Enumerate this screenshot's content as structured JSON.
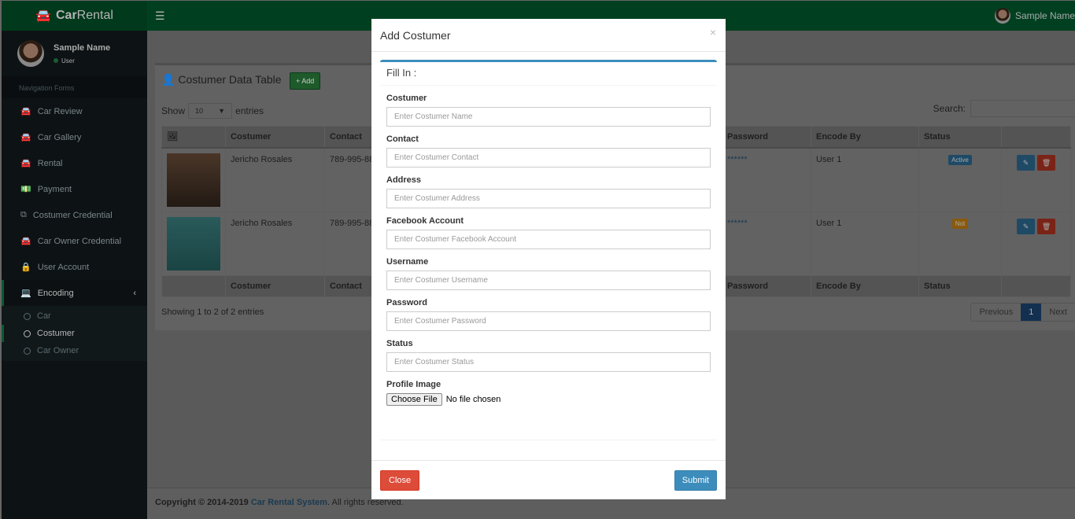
{
  "header": {
    "logo_bold": "Car",
    "logo_rest": "Rental",
    "user_name": "Sample Name"
  },
  "sidebar": {
    "user_name": "Sample Name",
    "user_status": "User",
    "nav_header": "Navigation Forms",
    "items": [
      {
        "label": "Car Review",
        "icon": "car-icon"
      },
      {
        "label": "Car Gallery",
        "icon": "car-icon"
      },
      {
        "label": "Rental",
        "icon": "car-icon"
      },
      {
        "label": "Payment",
        "icon": "money-icon"
      },
      {
        "label": "Costumer Credential",
        "icon": "copy-icon"
      },
      {
        "label": "Car Owner Credential",
        "icon": "car-icon"
      },
      {
        "label": "User Account",
        "icon": "lock-icon"
      }
    ],
    "encoding": {
      "label": "Encoding",
      "sub": [
        "Car",
        "Costumer",
        "Car Owner"
      ]
    }
  },
  "box": {
    "title": "Costumer Data Table",
    "add_label": "Add",
    "show_label": "Show",
    "entries_label": "entries",
    "show_value": "10",
    "search_label": "Search:",
    "columns": [
      "Costumer",
      "Contact",
      "Password",
      "Encode By",
      "Status"
    ],
    "rows": [
      {
        "costumer": "Jericho Rosales",
        "contact": "789-995-88",
        "password": "******",
        "encode_by": "User 1",
        "status": "Active",
        "status_color": "#3c8dbc"
      },
      {
        "costumer": "Jericho Rosales",
        "contact": "789-995-88",
        "password": "******",
        "encode_by": "User 1",
        "status": "Not",
        "status_color": "#f39c12"
      }
    ],
    "info": "Showing 1 to 2 of 2 entries",
    "prev": "Previous",
    "page": "1",
    "next": "Next"
  },
  "footer": {
    "prefix": "Copyright © 2014-2019 ",
    "link": "Car Rental System",
    "suffix": ". All rights reserved."
  },
  "modal": {
    "title": "Add Costumer",
    "panel_title": "Fill In :",
    "fields": [
      {
        "label": "Costumer",
        "placeholder": "Enter Costumer Name"
      },
      {
        "label": "Contact",
        "placeholder": "Enter Costumer Contact"
      },
      {
        "label": "Address",
        "placeholder": "Enter Costumer Address"
      },
      {
        "label": "Facebook Account",
        "placeholder": "Enter Costumer Facebook Account"
      },
      {
        "label": "Username",
        "placeholder": "Enter Costumer Username"
      },
      {
        "label": "Password",
        "placeholder": "Enter Costumer Password"
      },
      {
        "label": "Status",
        "placeholder": "Enter Costumer Status"
      }
    ],
    "file_label": "Profile Image",
    "choose_file": "Choose File",
    "no_file": "No file chosen",
    "close": "Close",
    "submit": "Submit"
  }
}
